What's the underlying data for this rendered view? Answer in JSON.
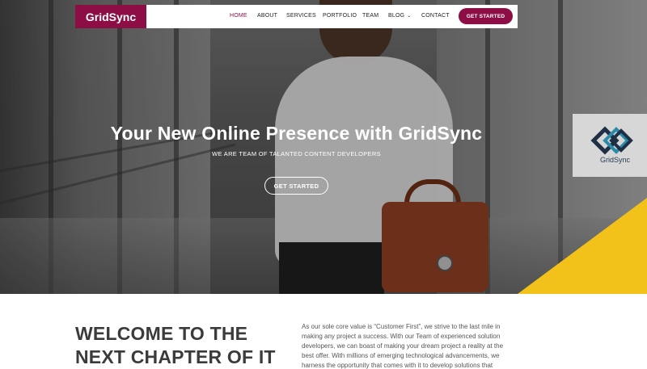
{
  "brand": {
    "name": "GridSync",
    "color": "#8c0e45"
  },
  "nav": {
    "items": [
      {
        "label": "HOME",
        "active": true
      },
      {
        "label": "ABOUT",
        "active": false
      },
      {
        "label": "SERVICES",
        "active": false
      },
      {
        "label": "PORTFOLIO",
        "active": false
      },
      {
        "label": "TEAM",
        "active": false
      },
      {
        "label": "BLOG",
        "active": false,
        "icon": "chevron-down-icon"
      },
      {
        "label": "CONTACT",
        "active": false
      }
    ],
    "cta_label": "GET STARTED"
  },
  "hero": {
    "title": "Your New Online Presence with GridSync",
    "subtitle": "WE ARE TEAM OF TALANTED CONTENT DEVELOPERS",
    "cta_label": "GET STARTED",
    "watermark_text": "GridSync",
    "accent_color": "#f2c21a"
  },
  "welcome": {
    "heading_line1": "WELCOME TO THE",
    "heading_line2": "NEXT CHAPTER OF IT",
    "body": "As our sole core value is “Customer First”, we strive to the last mile in making any project a success. With our Team of experienced solution developers, we can boast of making your dream project a reality at the best offer. With millions of emerging technological advancements, we harness the opportunity that comes with it to develop solutions that"
  }
}
